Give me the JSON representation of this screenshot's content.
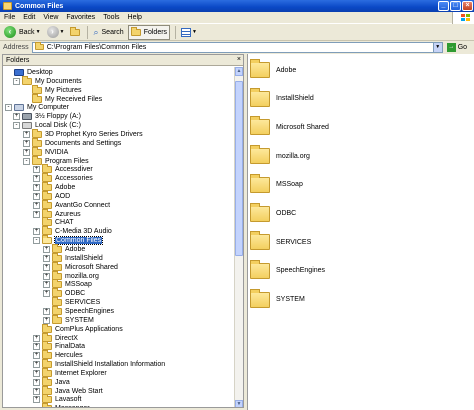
{
  "window": {
    "title": "Common Files"
  },
  "menu": [
    "File",
    "Edit",
    "View",
    "Favorites",
    "Tools",
    "Help"
  ],
  "toolbar": {
    "back": "Back",
    "search": "Search",
    "folders": "Folders"
  },
  "address": {
    "label": "Address",
    "value": "C:\\Program Files\\Common Files",
    "go": "Go"
  },
  "folders_pane": {
    "title": "Folders"
  },
  "tree": [
    {
      "label": "Desktop",
      "icon": "desktop-icon",
      "expander": ""
    },
    {
      "label": "My Documents",
      "icon": "my-documents-icon",
      "expander": "-"
    },
    {
      "label": "My Pictures",
      "icon": "folder-icon",
      "expander": ""
    },
    {
      "label": "My Received Files",
      "icon": "folder-icon",
      "expander": ""
    },
    {
      "label": "My Computer",
      "icon": "computer-icon",
      "expander": "-"
    },
    {
      "label": "3½ Floppy (A:)",
      "icon": "floppy-icon",
      "expander": "+"
    },
    {
      "label": "Local Disk (C:)",
      "icon": "disk-icon",
      "expander": "-"
    },
    {
      "label": "3D Prophet Kyro Series Drivers",
      "icon": "folder-icon",
      "expander": "+"
    },
    {
      "label": "Documents and Settings",
      "icon": "folder-icon",
      "expander": "+"
    },
    {
      "label": "NVIDIA",
      "icon": "folder-icon",
      "expander": "+"
    },
    {
      "label": "Program Files",
      "icon": "folder-icon",
      "expander": "-"
    },
    {
      "label": "Accessdiver",
      "icon": "folder-icon",
      "expander": "+"
    },
    {
      "label": "Accessories",
      "icon": "folder-icon",
      "expander": "+"
    },
    {
      "label": "Adobe",
      "icon": "folder-icon",
      "expander": "+"
    },
    {
      "label": "AOD",
      "icon": "folder-icon",
      "expander": "+"
    },
    {
      "label": "AvantGo Connect",
      "icon": "folder-icon",
      "expander": "+"
    },
    {
      "label": "Azureus",
      "icon": "folder-icon",
      "expander": "+"
    },
    {
      "label": "CHAT",
      "icon": "folder-icon",
      "expander": ""
    },
    {
      "label": "C-Media 3D Audio",
      "icon": "folder-icon",
      "expander": "+"
    },
    {
      "label": "Common Files",
      "icon": "folder-open-icon",
      "expander": "-",
      "selected": true
    },
    {
      "label": "Adobe",
      "icon": "folder-icon",
      "expander": "+"
    },
    {
      "label": "InstallShield",
      "icon": "folder-icon",
      "expander": "+"
    },
    {
      "label": "Microsoft Shared",
      "icon": "folder-icon",
      "expander": "+"
    },
    {
      "label": "mozilla.org",
      "icon": "folder-icon",
      "expander": "+"
    },
    {
      "label": "MSSoap",
      "icon": "folder-icon",
      "expander": "+"
    },
    {
      "label": "ODBC",
      "icon": "folder-icon",
      "expander": "+"
    },
    {
      "label": "SERVICES",
      "icon": "folder-icon",
      "expander": ""
    },
    {
      "label": "SpeechEngines",
      "icon": "folder-icon",
      "expander": "+"
    },
    {
      "label": "SYSTEM",
      "icon": "folder-icon",
      "expander": "+"
    },
    {
      "label": "ComPlus Applications",
      "icon": "folder-icon",
      "expander": ""
    },
    {
      "label": "DirectX",
      "icon": "folder-icon",
      "expander": "+"
    },
    {
      "label": "FinalData",
      "icon": "folder-icon",
      "expander": "+"
    },
    {
      "label": "Hercules",
      "icon": "folder-icon",
      "expander": "+"
    },
    {
      "label": "InstallShield Installation Information",
      "icon": "folder-icon",
      "expander": "+"
    },
    {
      "label": "Internet Explorer",
      "icon": "folder-icon",
      "expander": "+"
    },
    {
      "label": "Java",
      "icon": "folder-icon",
      "expander": "+"
    },
    {
      "label": "Java Web Start",
      "icon": "folder-icon",
      "expander": "+"
    },
    {
      "label": "Lavasoft",
      "icon": "folder-icon",
      "expander": "+"
    },
    {
      "label": "Messenger",
      "icon": "folder-icon",
      "expander": ""
    }
  ],
  "contents": [
    "Adobe",
    "InstallShield",
    "Microsoft Shared",
    "mozilla.org",
    "MSSoap",
    "ODBC",
    "SERVICES",
    "SpeechEngines",
    "SYSTEM"
  ],
  "colors": {
    "title_bar": "#0a48c6",
    "selection": "#316ac5",
    "folder": "#f3d36c"
  }
}
